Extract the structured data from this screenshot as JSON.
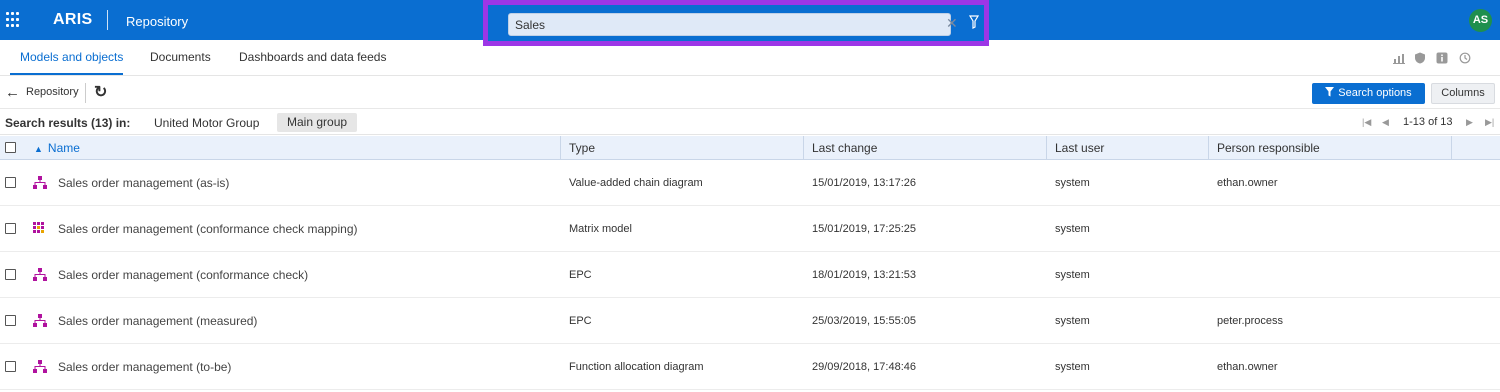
{
  "topbar": {
    "brand": "ARIS",
    "app_title": "Repository",
    "search": {
      "value": "Sales",
      "clear_icon": "close-icon",
      "filter_icon": "filter-icon"
    },
    "avatar_initials": "AS",
    "colors": {
      "bar": "#0a6ed1",
      "search_highlight": "#9d36e6",
      "avatar": "#1f8f4e"
    }
  },
  "tabs": [
    {
      "label": "Models and objects",
      "active": true
    },
    {
      "label": "Documents",
      "active": false
    },
    {
      "label": "Dashboards and data feeds",
      "active": false
    }
  ],
  "tab_icons": [
    "bar-chart-icon",
    "shield-icon",
    "info-icon",
    "history-icon"
  ],
  "toolbar": {
    "back_label": "Repository",
    "search_options_label": "Search options",
    "columns_label": "Columns"
  },
  "results": {
    "label": "Search results (13) in:",
    "chips": [
      "United Motor Group",
      "Main group"
    ],
    "pager_text": "1-13 of 13"
  },
  "table": {
    "columns": [
      "Name",
      "Type",
      "Last change",
      "Last user",
      "Person responsible"
    ],
    "sort": {
      "column": "Name",
      "direction": "ascending"
    },
    "rows": [
      {
        "name": "Sales order management (as-is)",
        "icon": "hierarchy-model-icon",
        "type": "Value-added chain diagram",
        "last_change": "15/01/2019, 13:17:26",
        "last_user": "system",
        "person": "ethan.owner"
      },
      {
        "name": "Sales order management (conformance check mapping)",
        "icon": "matrix-model-icon",
        "type": "Matrix model",
        "last_change": "15/01/2019, 17:25:25",
        "last_user": "system",
        "person": ""
      },
      {
        "name": "Sales order management (conformance check)",
        "icon": "hierarchy-model-icon",
        "type": "EPC",
        "last_change": "18/01/2019, 13:21:53",
        "last_user": "system",
        "person": ""
      },
      {
        "name": "Sales order management (measured)",
        "icon": "hierarchy-model-icon",
        "type": "EPC",
        "last_change": "25/03/2019, 15:55:05",
        "last_user": "system",
        "person": "peter.process"
      },
      {
        "name": "Sales order management (to-be)",
        "icon": "hierarchy-model-icon",
        "type": "Function allocation diagram",
        "last_change": "29/09/2018, 17:48:46",
        "last_user": "system",
        "person": "ethan.owner"
      }
    ]
  }
}
